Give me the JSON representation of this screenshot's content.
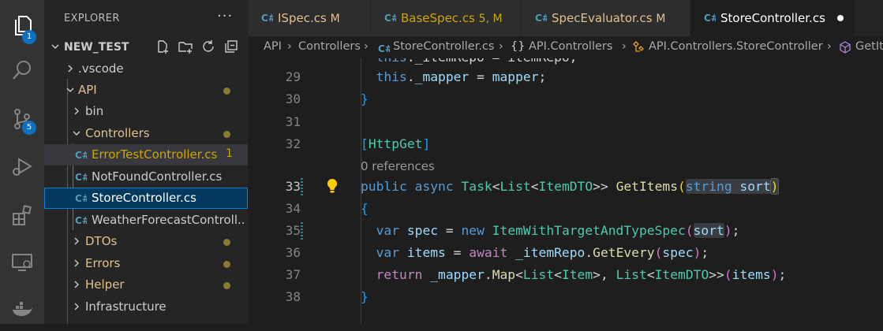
{
  "activity_bar": {
    "explorer_badge": "1",
    "source_control_badge": "5"
  },
  "sidebar": {
    "title": "EXPLORER",
    "more": "···",
    "project": "NEW_TEST",
    "tree": [
      {
        "label": ".vscode",
        "type": "folder",
        "state": "collapsed",
        "depth": 1
      },
      {
        "label": "API",
        "type": "folder",
        "state": "expanded",
        "depth": 1,
        "modified": true
      },
      {
        "label": "bin",
        "type": "folder",
        "state": "collapsed",
        "depth": 2
      },
      {
        "label": "Controllers",
        "type": "folder",
        "state": "expanded",
        "depth": 2,
        "modified": true
      },
      {
        "label": "ErrorTestController.cs",
        "type": "file",
        "depth": 3,
        "badge": "1"
      },
      {
        "label": "NotFoundController.cs",
        "type": "file",
        "depth": 3
      },
      {
        "label": "StoreController.cs",
        "type": "file",
        "depth": 3,
        "selected": true
      },
      {
        "label": "WeatherForecastControll...",
        "type": "file",
        "depth": 3
      },
      {
        "label": "DTOs",
        "type": "folder",
        "state": "collapsed",
        "depth": 2,
        "modified": true
      },
      {
        "label": "Errors",
        "type": "folder",
        "state": "collapsed",
        "depth": 2,
        "modified": true
      },
      {
        "label": "Helper",
        "type": "folder",
        "state": "collapsed",
        "depth": 2,
        "modified": true
      },
      {
        "label": "Infrastructure",
        "type": "folder",
        "state": "collapsed",
        "depth": 2
      }
    ]
  },
  "tabs": [
    {
      "name": "ISpec.cs",
      "status": "M",
      "color": "#e2c08d"
    },
    {
      "name": "BaseSpec.cs",
      "status": "5, M",
      "color": "#cca700"
    },
    {
      "name": "SpecEvaluator.cs",
      "status": "M",
      "color": "#e2c08d"
    },
    {
      "name": "StoreController.cs",
      "status": "",
      "color": "#ffffff",
      "active": true
    }
  ],
  "breadcrumb": [
    "API",
    "Controllers",
    "StoreController.cs",
    "API.Controllers",
    "API.Controllers.StoreController",
    "GetIt"
  ],
  "editor": {
    "line_29": "29",
    "line_30": "30",
    "line_31": "31",
    "line_32": "32",
    "line_33": "33",
    "line_34": "34",
    "line_35": "35",
    "line_36": "36",
    "line_37": "37",
    "line_38": "38",
    "code_lens": "0 references"
  },
  "colors": {
    "accent": "#007fd4",
    "modified": "#e2c08d",
    "warning": "#cca700"
  }
}
